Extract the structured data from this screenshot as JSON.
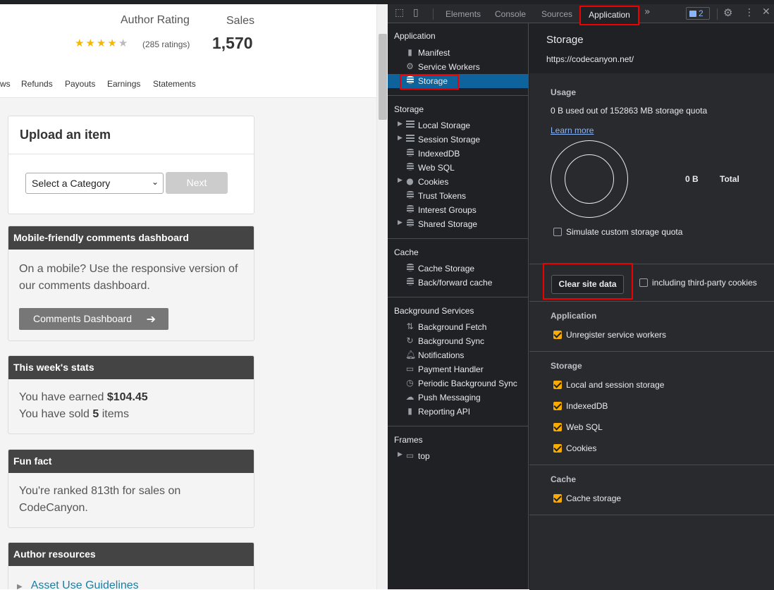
{
  "site": {
    "author_rating_label": "Author Rating",
    "sales_label": "Sales",
    "rating_stars": 4,
    "ratings_text": "(285 ratings)",
    "sales_value": "1,570",
    "tabs": [
      "ws",
      "Refunds",
      "Payouts",
      "Earnings",
      "Statements"
    ],
    "upload": {
      "title": "Upload an item",
      "select_value": "Select a Category",
      "next_label": "Next"
    },
    "mobile": {
      "title": "Mobile-friendly comments dashboard",
      "text": "On a mobile? Use the responsive version of our comments dashboard.",
      "button": "Comments Dashboard"
    },
    "stats": {
      "title": "This week's stats",
      "earned_prefix": "You have earned ",
      "earned_value": "$104.45",
      "sold_prefix": "You have sold ",
      "sold_value": "5",
      "sold_suffix": " items"
    },
    "fun": {
      "title": "Fun fact",
      "text": "You're ranked 813th for sales on CodeCanyon."
    },
    "resources": {
      "title": "Author resources",
      "link": "Asset Use Guidelines"
    }
  },
  "devtools": {
    "tabs": [
      "Elements",
      "Console",
      "Sources",
      "Application"
    ],
    "active_tab": "Application",
    "issues_count": "2",
    "sidebar": {
      "application": {
        "title": "Application",
        "items": [
          "Manifest",
          "Service Workers",
          "Storage"
        ]
      },
      "storage": {
        "title": "Storage",
        "items": [
          "Local Storage",
          "Session Storage",
          "IndexedDB",
          "Web SQL",
          "Cookies",
          "Trust Tokens",
          "Interest Groups",
          "Shared Storage"
        ]
      },
      "cache": {
        "title": "Cache",
        "items": [
          "Cache Storage",
          "Back/forward cache"
        ]
      },
      "background": {
        "title": "Background Services",
        "items": [
          "Background Fetch",
          "Background Sync",
          "Notifications",
          "Payment Handler",
          "Periodic Background Sync",
          "Push Messaging",
          "Reporting API"
        ]
      },
      "frames": {
        "title": "Frames",
        "items": [
          "top"
        ]
      }
    },
    "main": {
      "title": "Storage",
      "origin": "https://codecanyon.net/",
      "usage_head": "Usage",
      "usage_text": "0 B used out of 152863 MB storage quota",
      "learn_more": "Learn more",
      "usage_value": "0 B",
      "usage_total": "Total",
      "simulate_label": "Simulate custom storage quota",
      "clear_button": "Clear site data",
      "third_party_label": "including third-party cookies",
      "application_head": "Application",
      "unregister_label": "Unregister service workers",
      "storage_head": "Storage",
      "storage_opts": [
        "Local and session storage",
        "IndexedDB",
        "Web SQL",
        "Cookies"
      ],
      "cache_head": "Cache",
      "cache_opt": "Cache storage"
    },
    "colors": {
      "highlight": "#ee0000",
      "selected": "#0e639c",
      "checkbox": "#f9ab00"
    }
  }
}
